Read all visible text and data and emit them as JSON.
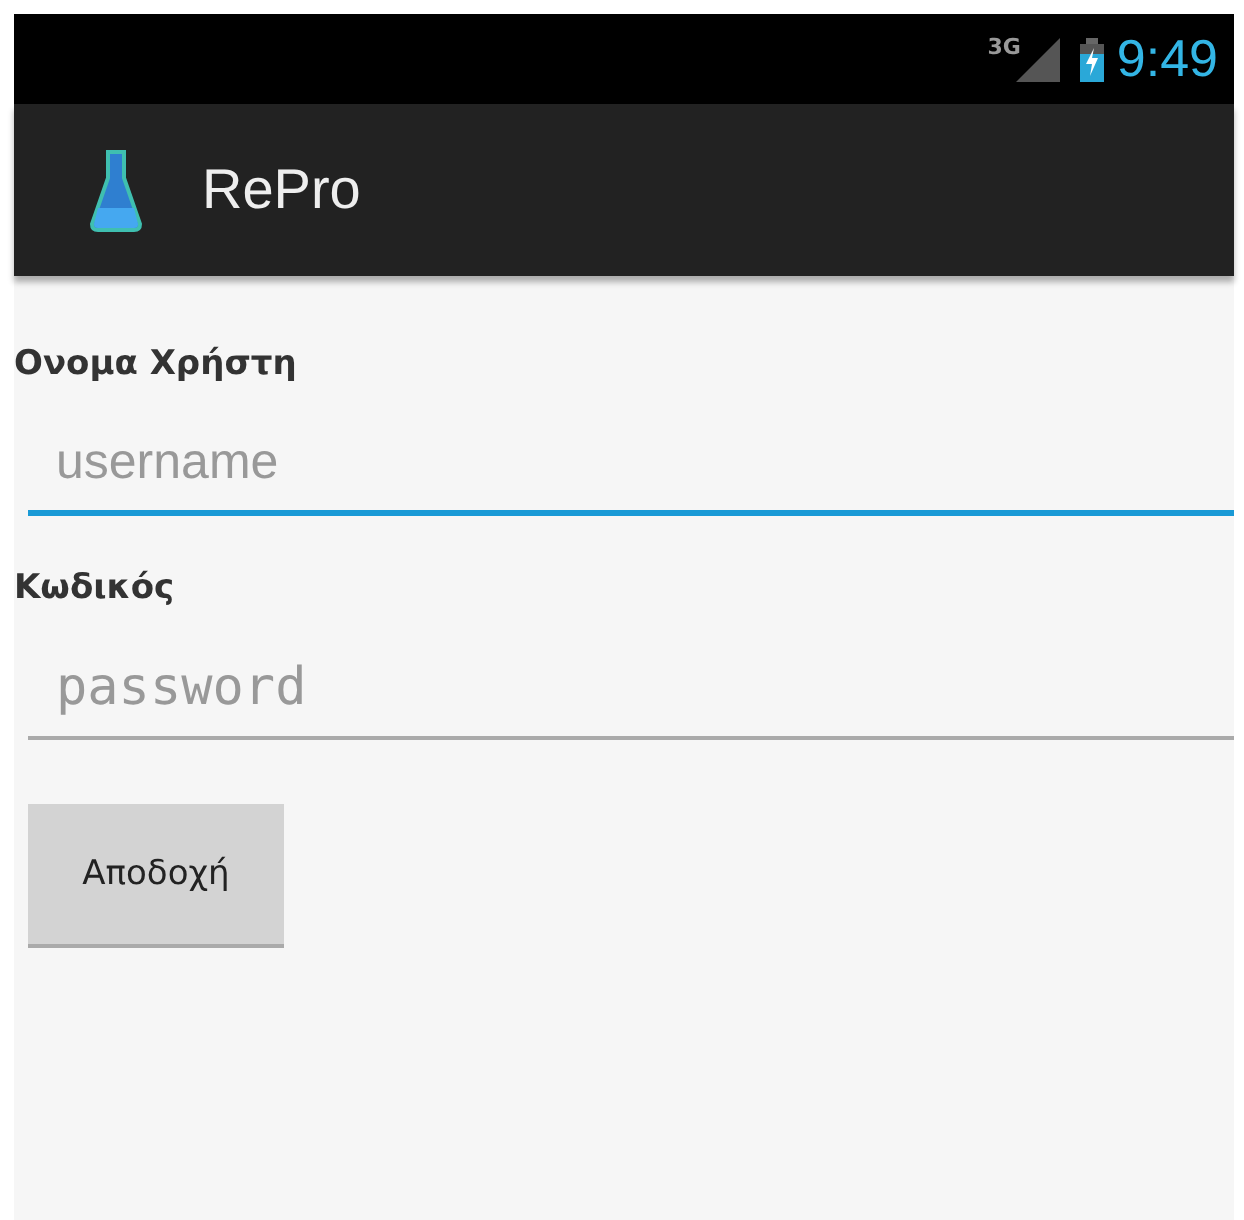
{
  "status_bar": {
    "network": "3G",
    "time": "9:49"
  },
  "action_bar": {
    "title": "RePro"
  },
  "fields": [
    {
      "label": "Ονομα Χρήστη",
      "placeholder": "username",
      "kind": "text",
      "focused": true
    },
    {
      "label": "Κωδικός",
      "placeholder": "password",
      "kind": "password",
      "focused": false
    }
  ],
  "button": "Αποδοχή"
}
